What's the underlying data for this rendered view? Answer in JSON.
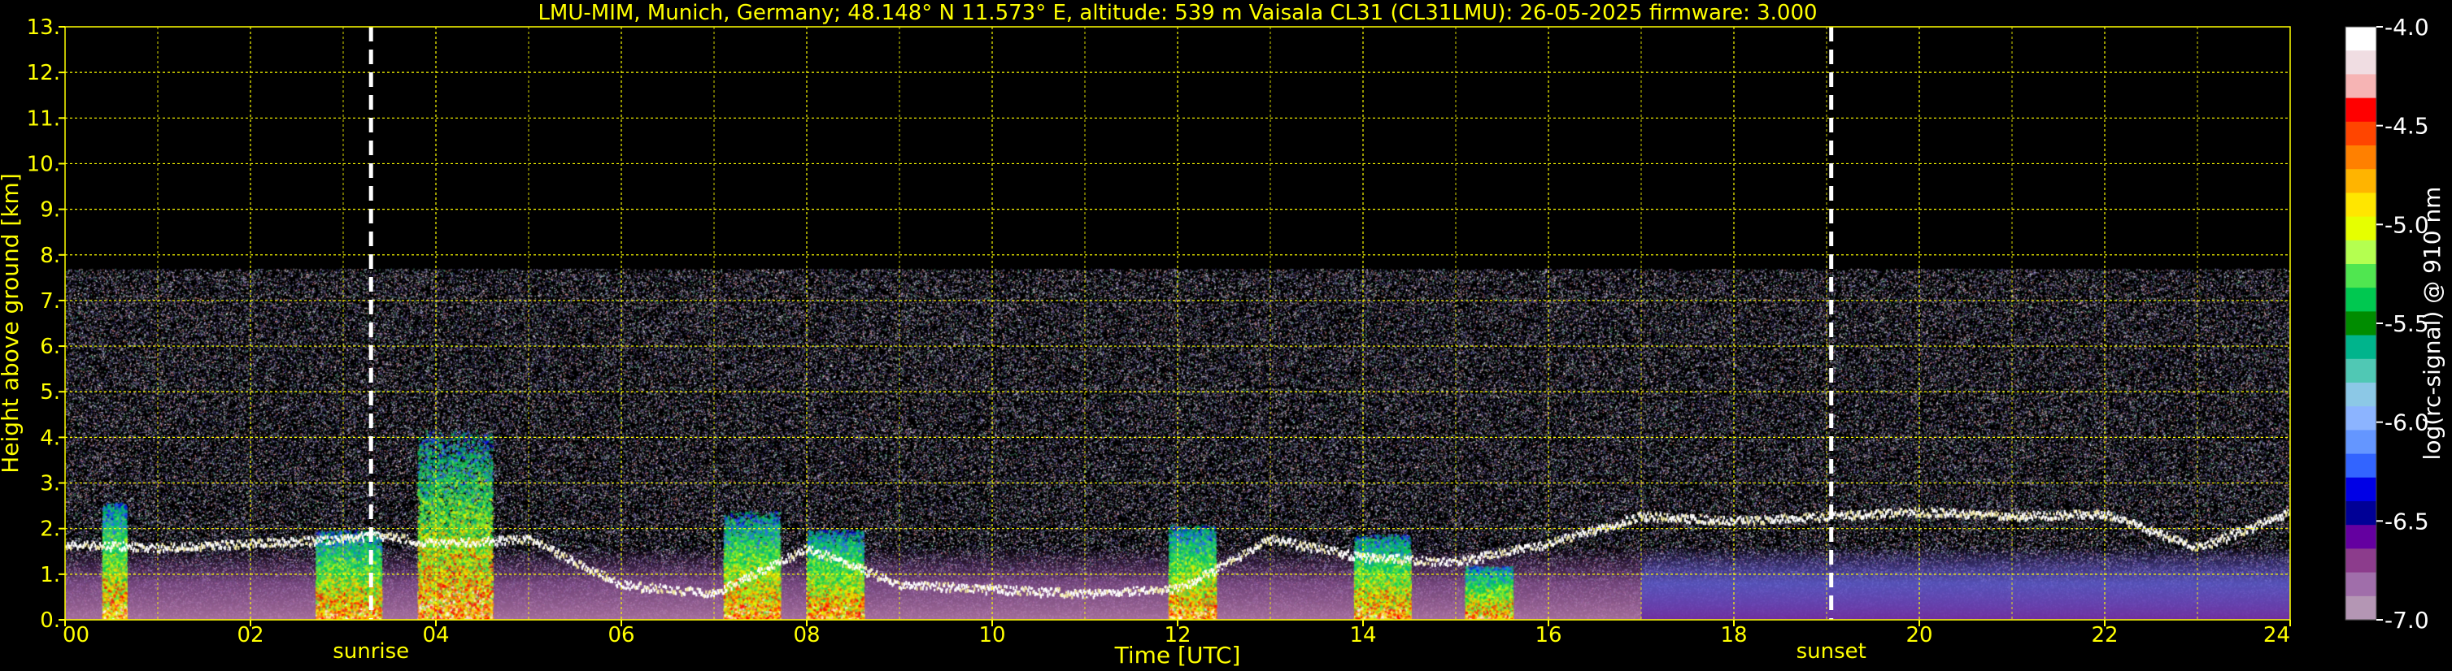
{
  "chart_data": {
    "type": "heatmap",
    "title": "LMU-MIM, Munich, Germany; 48.148° N 11.573° E, altitude: 539 m    Vaisala CL31 (CL31LMU): 26-05-2025    firmware: 3.000",
    "xlabel": "Time [UTC]",
    "ylabel": "Height above ground [km]",
    "xlim": [
      0,
      24
    ],
    "ylim": [
      0,
      13
    ],
    "x_ticks": [
      0,
      2,
      4,
      6,
      8,
      10,
      12,
      14,
      16,
      18,
      20,
      22,
      24
    ],
    "x_tick_labels": [
      "00",
      "02",
      "04",
      "06",
      "08",
      "10",
      "12",
      "14",
      "16",
      "18",
      "20",
      "22",
      "24"
    ],
    "y_ticks": [
      0,
      1,
      2,
      3,
      4,
      5,
      6,
      7,
      8,
      9,
      10,
      11,
      12,
      13
    ],
    "y_tick_labels": [
      "0.",
      "1.",
      "2.",
      "3.",
      "4.",
      "5.",
      "6.",
      "7.",
      "8.",
      "9.",
      "10.",
      "11.",
      "12.",
      "13."
    ],
    "grid": true,
    "annotations": [
      {
        "label": "sunrise",
        "time": 3.3
      },
      {
        "label": "sunset",
        "time": 19.05
      }
    ],
    "signal_top_km": 7.7,
    "cloud_layer": {
      "times": [
        0,
        1,
        2,
        3,
        3.3,
        4,
        5,
        6,
        7,
        8,
        9,
        10,
        11,
        12,
        13,
        14,
        15,
        16,
        17,
        18,
        19,
        20,
        21,
        22,
        23,
        24
      ],
      "heights_km": [
        1.7,
        1.6,
        1.7,
        1.8,
        1.9,
        1.7,
        1.8,
        0.8,
        0.6,
        1.6,
        0.8,
        0.7,
        0.6,
        0.7,
        1.8,
        1.4,
        1.3,
        1.7,
        2.3,
        2.2,
        2.3,
        2.4,
        2.3,
        2.35,
        1.6,
        2.4
      ]
    },
    "aerosol_convection": [
      {
        "start": 0.4,
        "end": 0.65,
        "top_km": 2.6
      },
      {
        "start": 2.7,
        "end": 3.4,
        "top_km": 2.0
      },
      {
        "start": 3.8,
        "end": 4.6,
        "top_km": 4.2
      },
      {
        "start": 7.1,
        "end": 7.7,
        "top_km": 2.4
      },
      {
        "start": 8.0,
        "end": 8.6,
        "top_km": 2.0
      },
      {
        "start": 11.9,
        "end": 12.4,
        "top_km": 2.1
      },
      {
        "start": 13.9,
        "end": 14.5,
        "top_km": 1.9
      },
      {
        "start": 15.1,
        "end": 15.6,
        "top_km": 1.2
      }
    ],
    "colorbar": {
      "label": "log(rc-signal) @ 910 nm",
      "range": [
        -7.0,
        -4.0
      ],
      "ticks": [
        -4.0,
        -4.5,
        -5.0,
        -5.5,
        -6.0,
        -6.5,
        -7.0
      ],
      "tick_labels": [
        "-4.0",
        "-4.5",
        "-5.0",
        "-5.5",
        "-6.0",
        "-6.5",
        "-7.0"
      ],
      "colors": [
        "#ffffff",
        "#f0dde2",
        "#f6b4b4",
        "#ff0000",
        "#ff4500",
        "#ff8000",
        "#ffb400",
        "#ffe600",
        "#e6ff00",
        "#b4ff50",
        "#50e650",
        "#00c850",
        "#008c00",
        "#00b48c",
        "#50c8b4",
        "#8cc8e6",
        "#8cb4ff",
        "#6496ff",
        "#3264ff",
        "#0000e6",
        "#000096",
        "#6400a0",
        "#8c3c8c",
        "#a06eaa",
        "#b496b4"
      ],
      "style": {
        "text": "#ffffff",
        "tick": "#ffffff"
      }
    },
    "style": {
      "text_color": "#ffff00",
      "grid_color": "#ffff00",
      "background": "#000000",
      "marker_color": "#ffffff"
    }
  }
}
